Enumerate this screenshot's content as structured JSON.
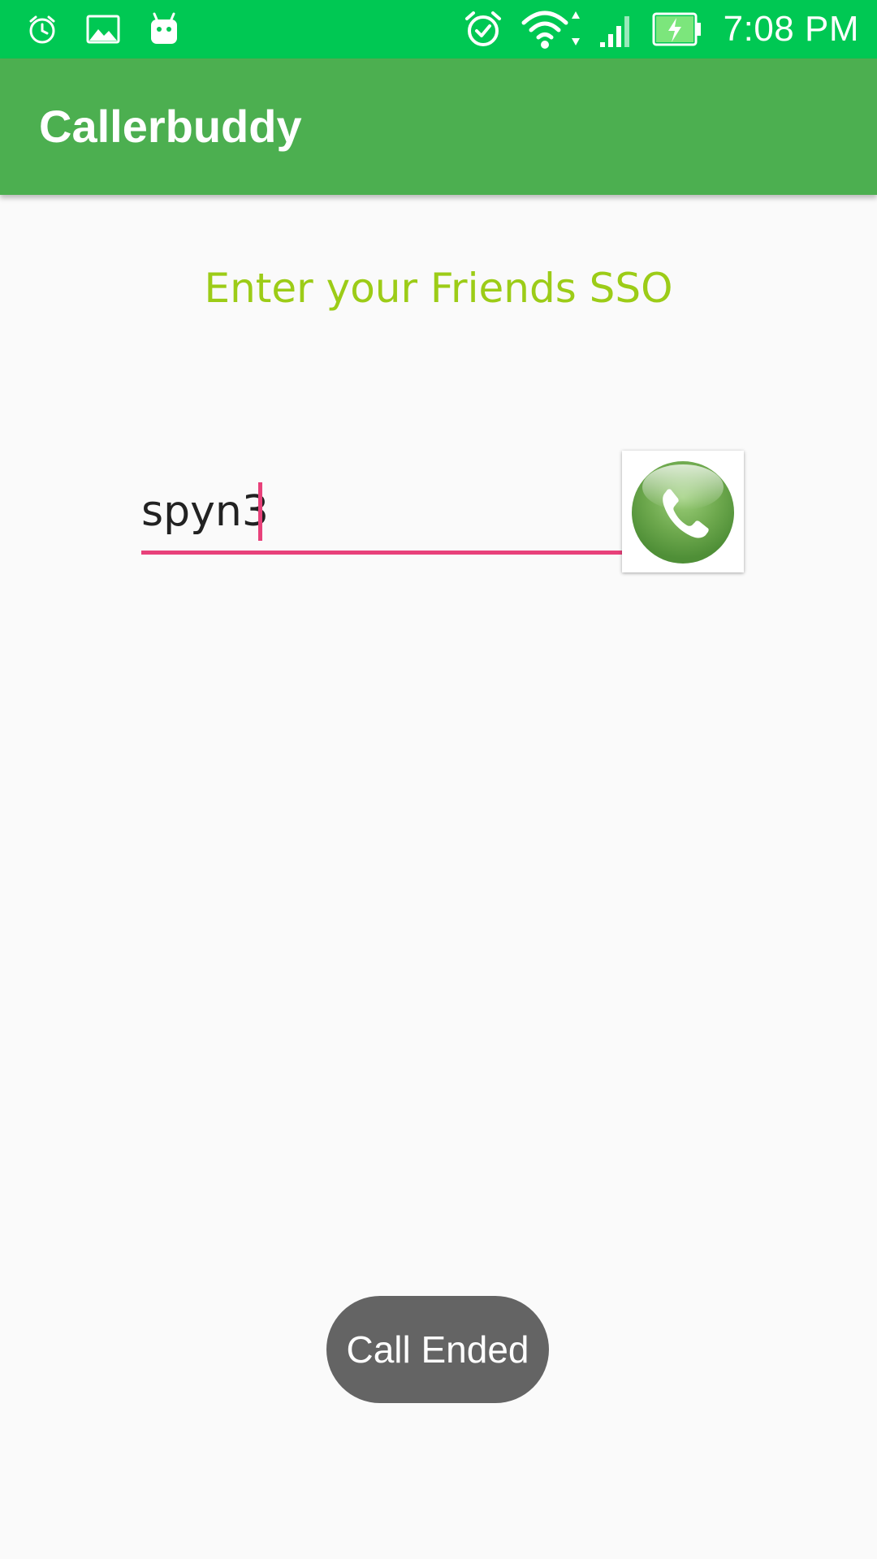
{
  "status_bar": {
    "time": "7:08 PM",
    "left_icons": [
      "alarm-clock-icon",
      "image-icon",
      "android-debug-icon"
    ],
    "right_icons": [
      "alarm-check-icon",
      "wifi-icon",
      "signal-icon",
      "battery-charging-icon"
    ],
    "background": "#00c853"
  },
  "app_bar": {
    "title": "Callerbuddy",
    "background": "#4caf50"
  },
  "main": {
    "prompt": "Enter your Friends SSO",
    "prompt_color": "#9ccc17",
    "sso_input": {
      "value": "spyn3",
      "accent_color": "#e8417a"
    },
    "call_button": {
      "icon": "phone-icon"
    }
  },
  "toast": {
    "text": "Call Ended"
  }
}
